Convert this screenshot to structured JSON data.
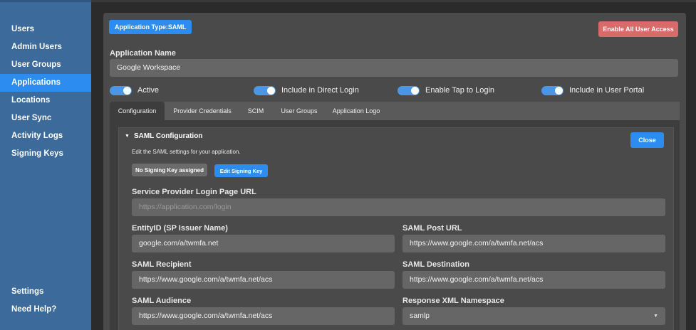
{
  "sidebar": {
    "items": [
      {
        "label": "Users"
      },
      {
        "label": "Admin Users"
      },
      {
        "label": "User Groups"
      },
      {
        "label": "Applications",
        "active": true
      },
      {
        "label": "Locations"
      },
      {
        "label": "User Sync"
      },
      {
        "label": "Activity Logs"
      },
      {
        "label": "Signing Keys"
      }
    ],
    "bottom_items": [
      {
        "label": "Settings"
      },
      {
        "label": "Need Help?"
      }
    ]
  },
  "header": {
    "type_badge": "Application Type:SAML",
    "enable_all_button": "Enable All User Access"
  },
  "app_name": {
    "label": "Application Name",
    "value": "Google Workspace"
  },
  "toggles": [
    {
      "label": "Active",
      "on": true
    },
    {
      "label": "Include in Direct Login",
      "on": true
    },
    {
      "label": "Enable Tap to Login",
      "on": true
    },
    {
      "label": "Include in User Portal",
      "on": true
    }
  ],
  "tabs": [
    {
      "label": "Configuration",
      "active": true
    },
    {
      "label": "Provider Credentials"
    },
    {
      "label": "SCIM"
    },
    {
      "label": "User Groups"
    },
    {
      "label": "Application Logo"
    }
  ],
  "saml": {
    "title": "SAML Configuration",
    "description": "Edit the SAML settings for your application.",
    "no_key_button": "No Signing Key assigned",
    "edit_key_button": "Edit Signing Key",
    "close_button": "Close",
    "fields": {
      "sp_login_url": {
        "label": "Service Provider Login Page URL",
        "value": "",
        "placeholder": "https://application.com/login"
      },
      "entity_id": {
        "label": "EntityID (SP Issuer Name)",
        "value": "google.com/a/twmfa.net"
      },
      "post_url": {
        "label": "SAML Post URL",
        "value": "https://www.google.com/a/twmfa.net/acs"
      },
      "recipient": {
        "label": "SAML Recipient",
        "value": "https://www.google.com/a/twmfa.net/acs"
      },
      "destination": {
        "label": "SAML Destination",
        "value": "https://www.google.com/a/twmfa.net/acs"
      },
      "audience": {
        "label": "SAML Audience",
        "value": "https://www.google.com/a/twmfa.net/acs"
      },
      "xml_namespace": {
        "label": "Response XML Namespace",
        "value": "samlp"
      }
    }
  },
  "colors": {
    "sidebar_bg": "#3c6a9a",
    "accent": "#2d8cf0",
    "danger": "#d96a6a",
    "panel_bg": "#4a4a4a"
  }
}
